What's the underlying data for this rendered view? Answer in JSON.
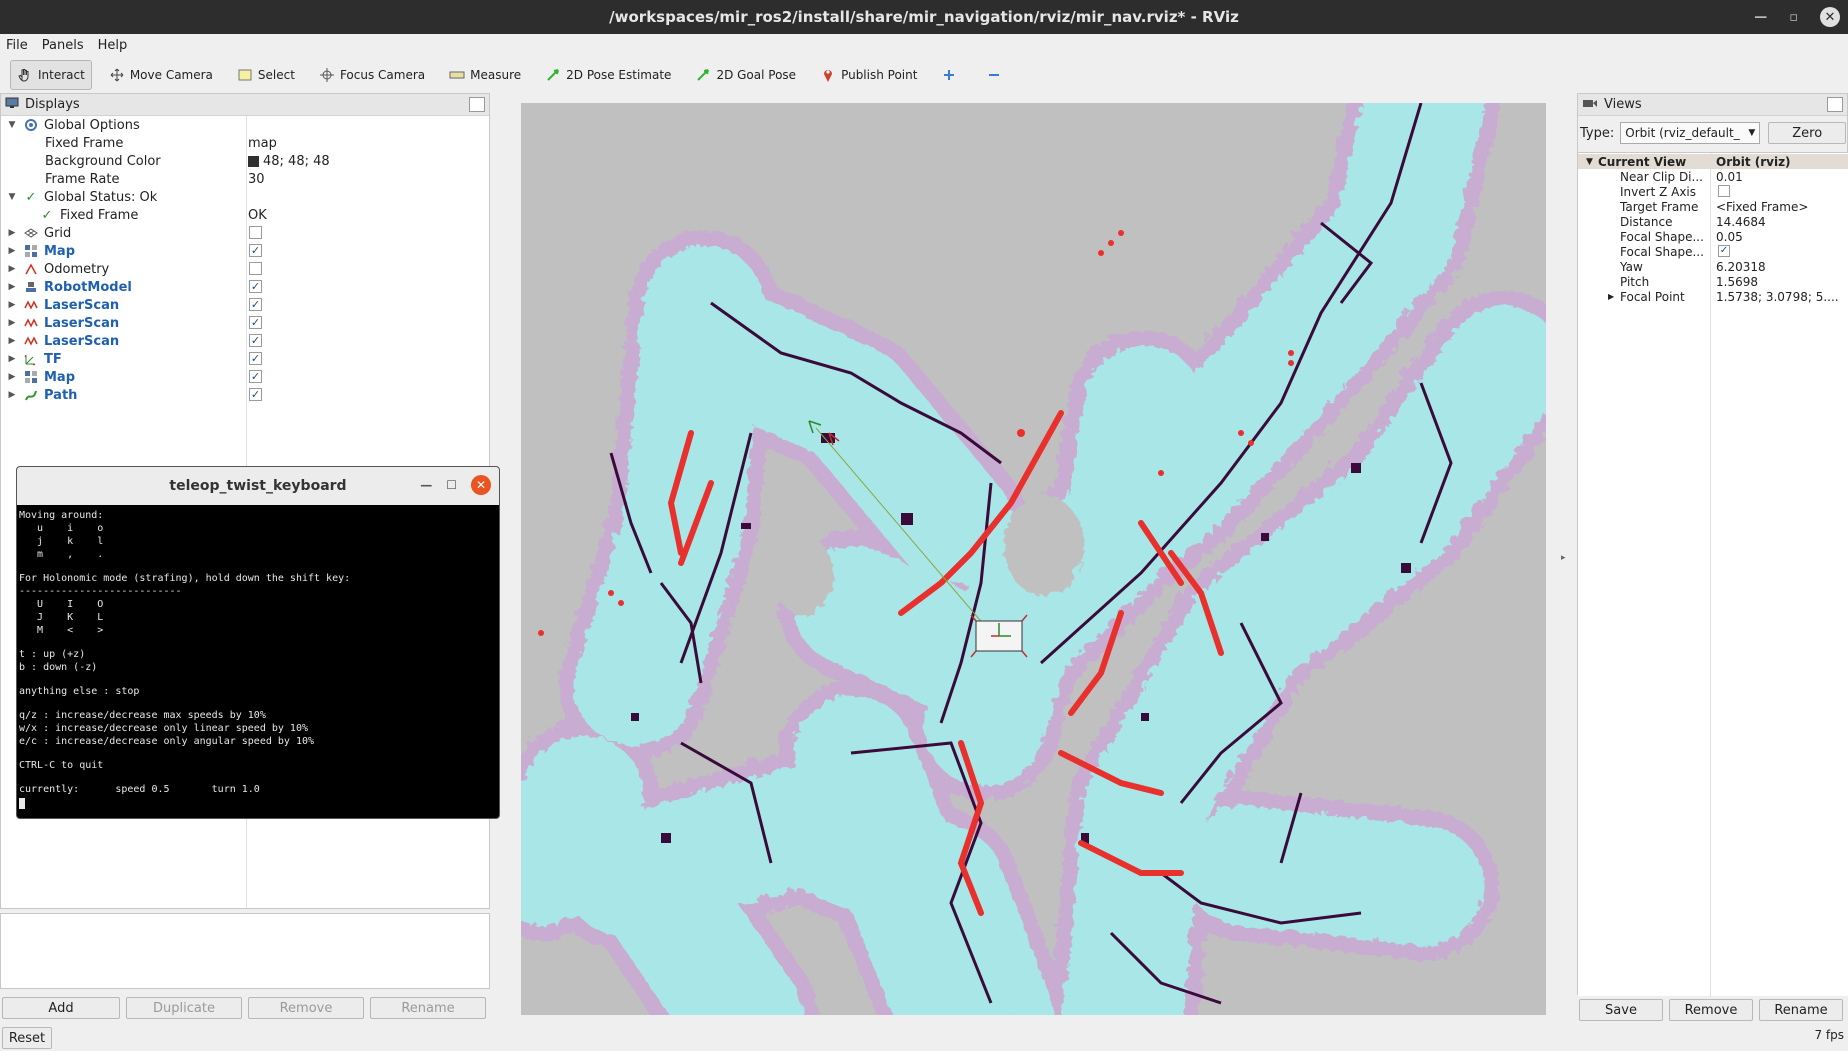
{
  "window": {
    "title": "/workspaces/mir_ros2/install/share/mir_navigation/rviz/mir_nav.rviz* - RViz"
  },
  "menu": [
    "File",
    "Panels",
    "Help"
  ],
  "toolbar": [
    {
      "label": "Interact",
      "icon": "hand-icon"
    },
    {
      "label": "Move Camera",
      "icon": "move-camera-icon"
    },
    {
      "label": "Select",
      "icon": "select-icon"
    },
    {
      "label": "Focus Camera",
      "icon": "focus-camera-icon"
    },
    {
      "label": "Measure",
      "icon": "ruler-icon"
    },
    {
      "label": "2D Pose Estimate",
      "icon": "pose-estimate-icon"
    },
    {
      "label": "2D Goal Pose",
      "icon": "goal-pose-icon"
    },
    {
      "label": "Publish Point",
      "icon": "pin-icon"
    }
  ],
  "displays": {
    "title": "Displays",
    "global_options": {
      "label": "Global Options",
      "fixed_frame": {
        "k": "Fixed Frame",
        "v": "map"
      },
      "background_color": {
        "k": "Background Color",
        "v": "48; 48; 48"
      },
      "frame_rate": {
        "k": "Frame Rate",
        "v": "30"
      }
    },
    "global_status": {
      "label": "Global Status: Ok",
      "fixed_frame": {
        "k": "Fixed Frame",
        "v": "OK"
      }
    },
    "items": [
      {
        "label": "Grid",
        "checked": false,
        "bold": false
      },
      {
        "label": "Map",
        "checked": true,
        "bold": true
      },
      {
        "label": "Odometry",
        "checked": false,
        "bold": false
      },
      {
        "label": "RobotModel",
        "checked": true,
        "bold": true
      },
      {
        "label": "LaserScan",
        "checked": true,
        "bold": true
      },
      {
        "label": "LaserScan",
        "checked": true,
        "bold": true
      },
      {
        "label": "LaserScan",
        "checked": true,
        "bold": true
      },
      {
        "label": "TF",
        "checked": true,
        "bold": true
      },
      {
        "label": "Map",
        "checked": true,
        "bold": true
      },
      {
        "label": "Path",
        "checked": true,
        "bold": true
      }
    ],
    "buttons": [
      "Add",
      "Duplicate",
      "Remove",
      "Rename"
    ],
    "reset": "Reset"
  },
  "teleop": {
    "title": "teleop_twist_keyboard",
    "lines": [
      "Moving around:",
      "   u    i    o",
      "   j    k    l",
      "   m    ,    .",
      "",
      "For Holonomic mode (strafing), hold down the shift key:",
      "---------------------------",
      "   U    I    O",
      "   J    K    L",
      "   M    <    >",
      "",
      "t : up (+z)",
      "b : down (-z)",
      "",
      "anything else : stop",
      "",
      "q/z : increase/decrease max speeds by 10%",
      "w/x : increase/decrease only linear speed by 10%",
      "e/c : increase/decrease only angular speed by 10%",
      "",
      "CTRL-C to quit",
      "",
      "currently:      speed 0.5       turn 1.0"
    ]
  },
  "views": {
    "title": "Views",
    "type_label": "Type:",
    "type_value": "Orbit (rviz_default_",
    "zero": "Zero",
    "current_view": {
      "k": "Current View",
      "v": "Orbit (rviz)"
    },
    "props": [
      {
        "k": "Near Clip Di...",
        "v": "0.01"
      },
      {
        "k": "Invert Z Axis",
        "v": ""
      },
      {
        "k": "Target Frame",
        "v": "<Fixed Frame>"
      },
      {
        "k": "Distance",
        "v": "14.4684"
      },
      {
        "k": "Focal Shape...",
        "v": "0.05"
      },
      {
        "k": "Focal Shape...",
        "v": ""
      },
      {
        "k": "Yaw",
        "v": "6.20318"
      },
      {
        "k": "Pitch",
        "v": "1.5698"
      },
      {
        "k": "Focal Point",
        "v": "1.5738; 3.0798; 5...."
      }
    ],
    "buttons": [
      "Save",
      "Remove",
      "Rename"
    ]
  },
  "status": {
    "fps": "7 fps"
  },
  "colors": {
    "costmap": "#a8e6e8",
    "inflation": "#c9a8d4",
    "scan": "#e8302c",
    "obstacle": "#3a0a3a",
    "background": "#c0c0c0"
  }
}
